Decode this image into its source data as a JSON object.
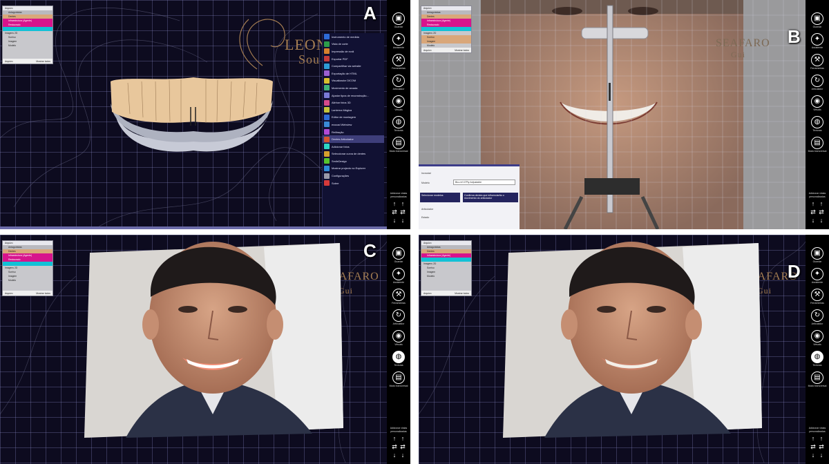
{
  "panels": [
    {
      "id": "a",
      "letter": "A"
    },
    {
      "id": "b",
      "letter": "B"
    },
    {
      "id": "c",
      "letter": "C"
    },
    {
      "id": "d",
      "letter": "D"
    }
  ],
  "logo": {
    "line1": "LEONA",
    "line2": "Sou",
    "b_line1": "SEAFARO",
    "b_line2": "Gui"
  },
  "toolbar": {
    "items": [
      {
        "label": "Guardar",
        "icon": "save-icon"
      },
      {
        "label": "Assistente",
        "icon": "wizard-icon"
      },
      {
        "label": "Ferramentas",
        "icon": "tools-icon"
      },
      {
        "label": "Articulador",
        "icon": "articulator-icon"
      },
      {
        "label": "Virtuais",
        "icon": "virtual-icon"
      },
      {
        "label": "Texturas",
        "icon": "texture-icon"
      },
      {
        "label": "Modo transversal",
        "icon": "layers-icon"
      }
    ],
    "custom_label": "Adicionar vistas personalizadas"
  },
  "layers": {
    "rows": [
      "Arquivo",
      "Antagonistas",
      "Dentes",
      "Infraestrutura (Agente)",
      "Restaurado",
      "",
      "Imagens 2D",
      "Sorriso",
      "Imagem",
      "Modelo"
    ],
    "footer_left": "Arquivo",
    "footer_right": "Mostrar todos"
  },
  "menu": {
    "items": [
      "Instrumento de medida",
      "Vista de corte",
      "Impressão de ecrã",
      "Exportar PDF",
      "Compartilhar via website",
      "Exportação de HTML",
      "Visualizador DICOM",
      "Movimento de arcada",
      "Ajustar tipos de reconstrução...",
      "Alinhar fotos 3D",
      "Lanterna Mágica",
      "Editor de montagem",
      "exocad Webview",
      "Reiltração",
      "Dentes Articulador",
      "Adicionar fotos",
      "Seleccionar curva de dentes",
      "SmileDesign",
      "Mostrar projecto no Explorer",
      "Configurações",
      "Sobre"
    ],
    "selected_index": 14
  },
  "settings_b": {
    "title": "Incrustal",
    "label": "Modelo",
    "select_value": "Bio-ref 47Ply Adjustable",
    "btn1": "Selecionar modelos",
    "btn2": "Confirma dentes que influenciarão o movimento do articulador",
    "label2": "Articulador",
    "label3": "Estado"
  },
  "colors": {
    "toolbar": "#000000",
    "menu": "#111133",
    "grid_bg": "#0d0b1f",
    "accent_magenta": "#d7148c",
    "accent_cyan": "#12c1d6",
    "accent_tan": "#d9a77a"
  }
}
